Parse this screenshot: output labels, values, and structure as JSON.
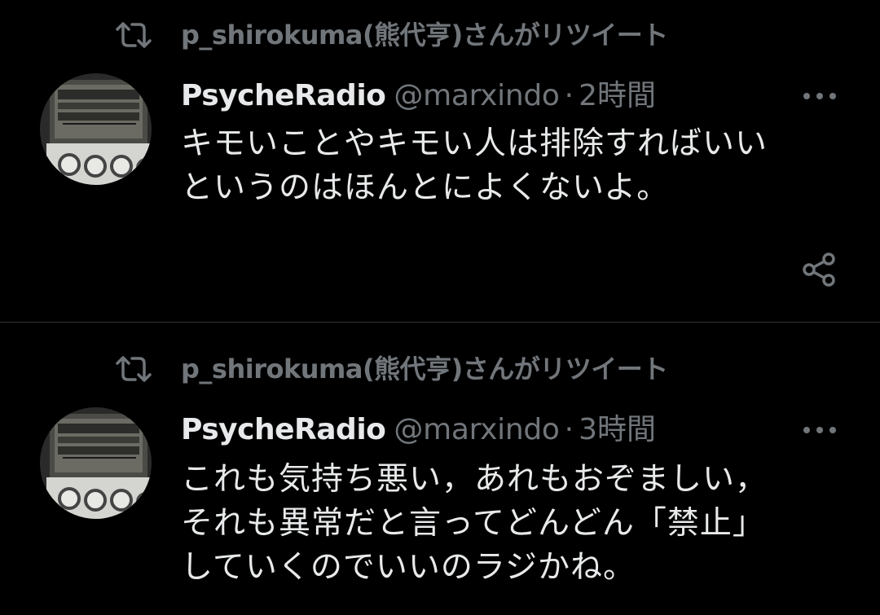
{
  "colors": {
    "background": "#000000",
    "primary_text": "#e7e9ea",
    "secondary_text": "#71767b",
    "divider": "#2f3336"
  },
  "icons": {
    "retweet": "retweet-icon",
    "more": "more-icon",
    "share": "share-icon"
  },
  "tweets": [
    {
      "retweet_label": "p_shirokuma(熊代亨)さんがリツイート",
      "display_name": "PsycheRadio",
      "handle": "@marxindo",
      "separator": "·",
      "time": "2時間",
      "text_lines": [
        "キモいことやキモい人は排除すればいい",
        "というのはほんとによくないよ。"
      ]
    },
    {
      "retweet_label": "p_shirokuma(熊代亨)さんがリツイート",
      "display_name": "PsycheRadio",
      "handle": "@marxindo",
      "separator": "·",
      "time": "3時間",
      "text_lines": [
        "これも気持ち悪い，あれもおぞましい，",
        "それも異常だと言ってどんどん「禁止」",
        "していくのでいいのラジかね。"
      ]
    }
  ]
}
